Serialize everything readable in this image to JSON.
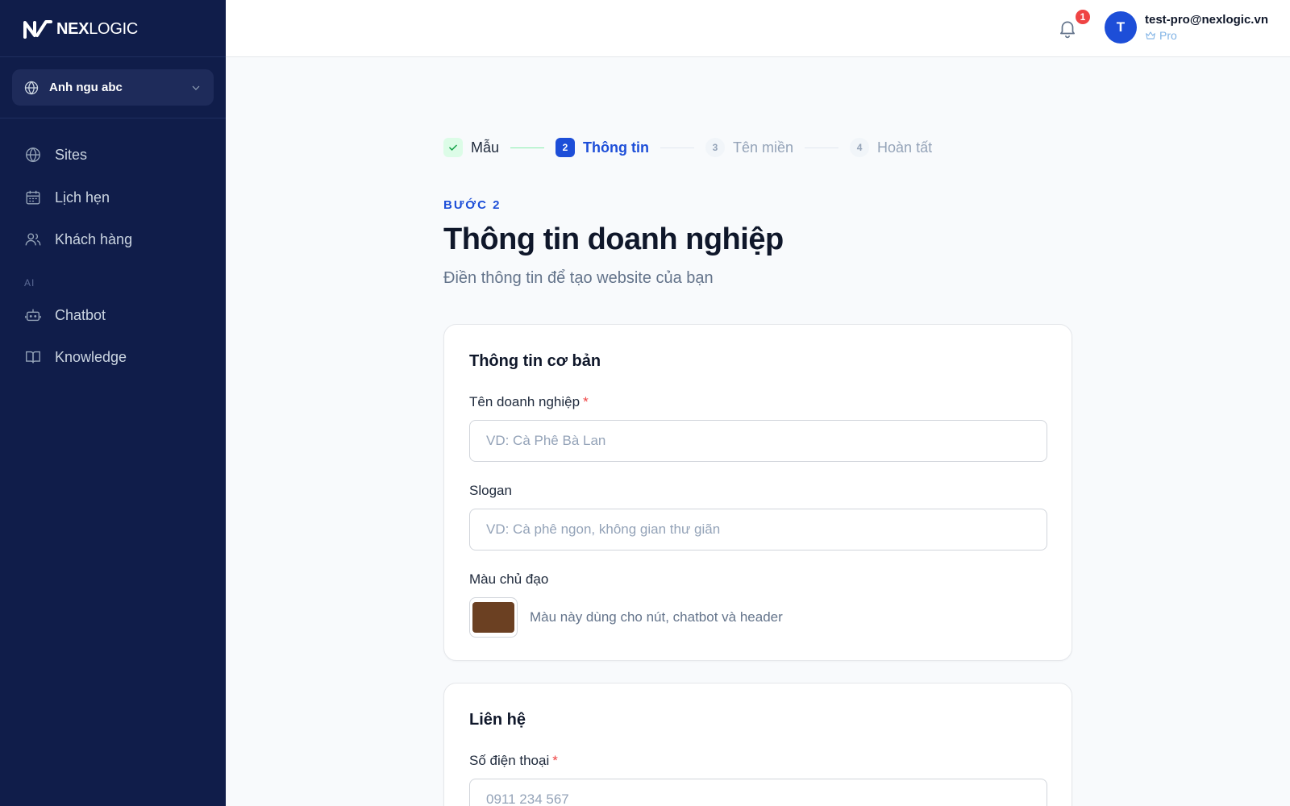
{
  "brand": {
    "logo_bold": "NEX",
    "logo_light": "LOGIC"
  },
  "site_selector": {
    "label": "Anh ngu abc"
  },
  "sidebar": {
    "items": [
      {
        "label": "Sites",
        "icon": "globe-icon"
      },
      {
        "label": "Lịch hẹn",
        "icon": "calendar-icon"
      },
      {
        "label": "Khách hàng",
        "icon": "users-icon"
      }
    ],
    "section_ai": "AI",
    "ai_items": [
      {
        "label": "Chatbot",
        "icon": "bot-icon"
      },
      {
        "label": "Knowledge",
        "icon": "book-icon"
      }
    ]
  },
  "header": {
    "notification_count": "1",
    "avatar_initial": "T",
    "user_email": "test-pro@nexlogic.vn",
    "user_plan": "Pro"
  },
  "stepper": {
    "steps": [
      {
        "number": "✓",
        "label": "Mẫu",
        "state": "done"
      },
      {
        "number": "2",
        "label": "Thông tin",
        "state": "active"
      },
      {
        "number": "3",
        "label": "Tên miền",
        "state": "todo"
      },
      {
        "number": "4",
        "label": "Hoàn tất",
        "state": "todo"
      }
    ]
  },
  "page": {
    "eyebrow": "BƯỚC 2",
    "title": "Thông tin doanh nghiệp",
    "subtitle": "Điền thông tin để tạo website của bạn"
  },
  "basic_info": {
    "title": "Thông tin cơ bản",
    "business_name_label": "Tên doanh nghiệp",
    "required_mark": "*",
    "business_name_value": "",
    "business_name_placeholder": "VD: Cà Phê Bà Lan",
    "slogan_label": "Slogan",
    "slogan_value": "",
    "slogan_placeholder": "VD: Cà phê ngon, không gian thư giãn",
    "color_label": "Màu chủ đạo",
    "color_value": "#6b4022",
    "color_hint": "Màu này dùng cho nút, chatbot và header"
  },
  "contact": {
    "title": "Liên hệ",
    "phone_label": "Số điện thoại",
    "required_mark": "*",
    "phone_value": "",
    "phone_placeholder": "0911 234 567"
  },
  "colors": {
    "sidebar_bg": "#101d4a",
    "accent": "#1d4ed8",
    "success": "#16a34a",
    "danger": "#ef4444"
  }
}
